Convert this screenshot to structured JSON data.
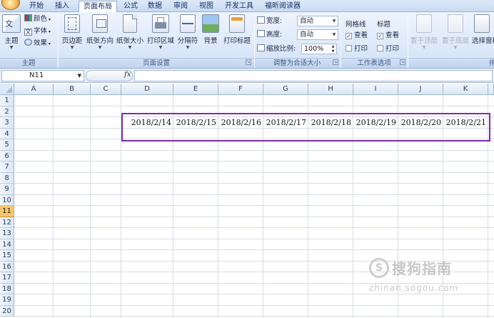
{
  "tabs": [
    "开始",
    "插入",
    "页面布局",
    "公式",
    "数据",
    "审阅",
    "视图",
    "开发工具",
    "福昕阅读器"
  ],
  "active_tab": "页面布局",
  "ribbon": {
    "theme_group": {
      "theme_button": "主题",
      "colors": "颜色",
      "fonts": "字体",
      "effects": "效果",
      "footer": "主题"
    },
    "page_setup": {
      "margins": "页边距",
      "orientation": "纸张方向",
      "size": "纸张大小",
      "print_area": "打印区域",
      "breaks": "分隔符",
      "background": "背景",
      "print_titles": "打印标题",
      "footer": "页面设置"
    },
    "scale_to_fit": {
      "width_label": "宽度:",
      "width_value": "自动",
      "height_label": "高度:",
      "height_value": "自动",
      "scale_label": "缩放比例:",
      "scale_value": "100%",
      "footer": "调整为合适大小"
    },
    "sheet_options": {
      "gridlines_title": "网格线",
      "headings_title": "标题",
      "view": "查看",
      "print": "打印",
      "gridlines_view_checked": true,
      "headings_view_checked": true,
      "footer": "工作表选项"
    },
    "arrange": {
      "bring_forward": "置于顶层",
      "send_backward": "置于底层",
      "selection_pane": "选择窗格",
      "footer": "排列"
    }
  },
  "formula_bar": {
    "name_box": "N11",
    "fx": "fx",
    "formula": ""
  },
  "sheet": {
    "columns": [
      "A",
      "B",
      "C",
      "D",
      "E",
      "F",
      "G",
      "H",
      "I",
      "J",
      "K"
    ],
    "rows": [
      "1",
      "2",
      "3",
      "4",
      "5",
      "6",
      "7",
      "8",
      "9",
      "10",
      "11",
      "12",
      "13",
      "14",
      "15",
      "16",
      "17",
      "18",
      "19",
      "20"
    ],
    "selected_row": "11",
    "row3_values": [
      "2018/2/14",
      "2018/2/15",
      "2018/2/16",
      "2018/2/17",
      "2018/2/18",
      "2018/2/19",
      "2018/2/20",
      "2018/2/21"
    ]
  },
  "watermark": {
    "name": "搜狗指南",
    "url": "zhinan.sogou.com"
  }
}
